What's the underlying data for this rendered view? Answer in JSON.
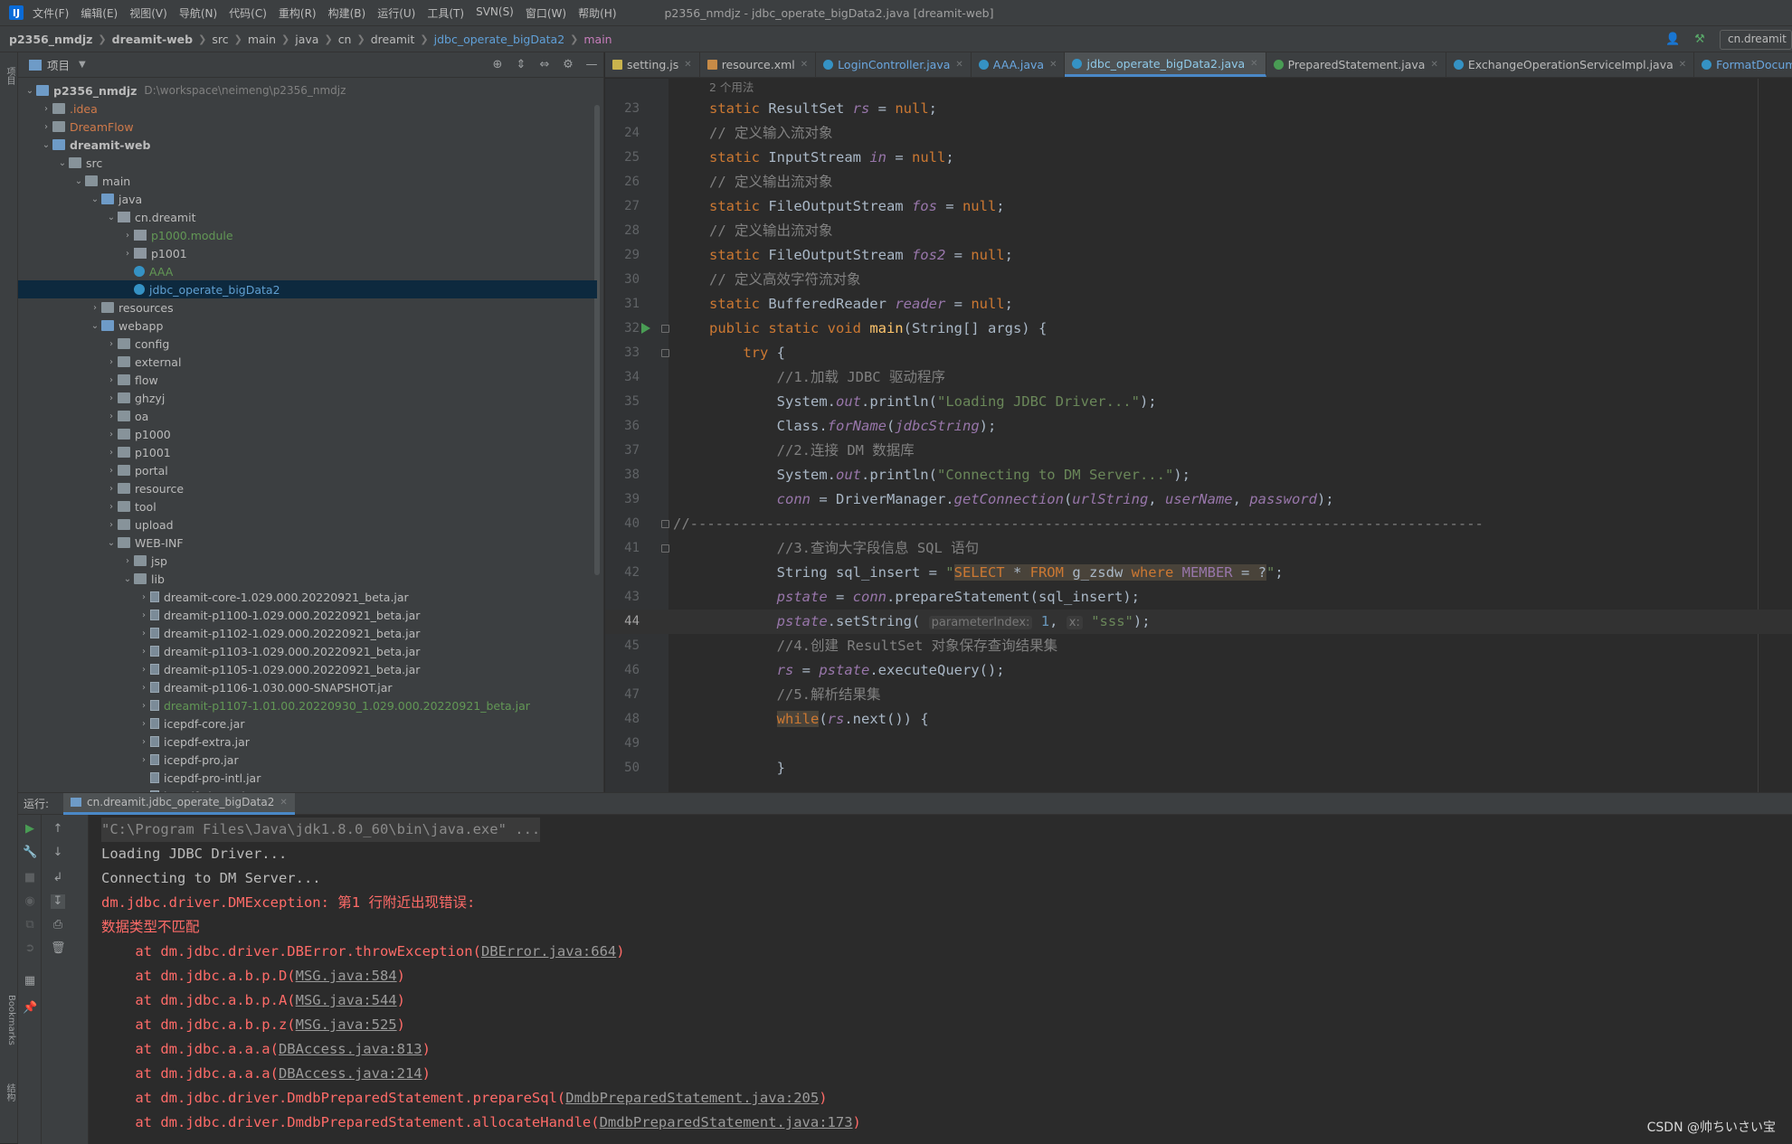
{
  "menubar": {
    "items": [
      "文件(F)",
      "编辑(E)",
      "视图(V)",
      "导航(N)",
      "代码(C)",
      "重构(R)",
      "构建(B)",
      "运行(U)",
      "工具(T)",
      "SVN(S)",
      "窗口(W)",
      "帮助(H)"
    ],
    "window_title": "p2356_nmdjz - jdbc_operate_bigData2.java [dreamit-web]"
  },
  "breadcrumb": [
    "p2356_nmdjz",
    "dreamit-web",
    "src",
    "main",
    "java",
    "cn",
    "dreamit",
    "jdbc_operate_bigData2",
    "main"
  ],
  "run_config": "cn.dreamit",
  "left_strip": {
    "project": "项目",
    "bookmarks": "Bookmarks",
    "structure": "结构"
  },
  "project_panel": {
    "title": "项目",
    "path": "D:\\workspace\\neimeng\\p2356_nmdjz"
  },
  "tree": [
    {
      "label": "p2356_nmdjz",
      "depth": 0,
      "arrow": "open",
      "icon": "folder-blue",
      "style": "bold",
      "path": true
    },
    {
      "label": ".idea",
      "depth": 1,
      "arrow": "closed",
      "icon": "folder",
      "style": "orange"
    },
    {
      "label": "DreamFlow",
      "depth": 1,
      "arrow": "closed",
      "icon": "folder",
      "style": "orange"
    },
    {
      "label": "dreamit-web",
      "depth": 1,
      "arrow": "open",
      "icon": "folder-blue",
      "style": "bold"
    },
    {
      "label": "src",
      "depth": 2,
      "arrow": "open",
      "icon": "folder",
      "style": ""
    },
    {
      "label": "main",
      "depth": 3,
      "arrow": "open",
      "icon": "folder",
      "style": ""
    },
    {
      "label": "java",
      "depth": 4,
      "arrow": "open",
      "icon": "folder-blue",
      "style": ""
    },
    {
      "label": "cn.dreamit",
      "depth": 5,
      "arrow": "open",
      "icon": "pkg",
      "style": ""
    },
    {
      "label": "p1000.module",
      "depth": 6,
      "arrow": "closed",
      "icon": "pkg",
      "style": "green"
    },
    {
      "label": "p1001",
      "depth": 6,
      "arrow": "closed",
      "icon": "pkg",
      "style": ""
    },
    {
      "label": "AAA",
      "depth": 6,
      "arrow": "none",
      "icon": "class",
      "style": "green"
    },
    {
      "label": "jdbc_operate_bigData2",
      "depth": 6,
      "arrow": "none",
      "icon": "class",
      "style": "green",
      "selected": true
    },
    {
      "label": "resources",
      "depth": 4,
      "arrow": "closed",
      "icon": "folder",
      "style": ""
    },
    {
      "label": "webapp",
      "depth": 4,
      "arrow": "open",
      "icon": "folder-blue",
      "style": ""
    },
    {
      "label": "config",
      "depth": 5,
      "arrow": "closed",
      "icon": "folder",
      "style": ""
    },
    {
      "label": "external",
      "depth": 5,
      "arrow": "closed",
      "icon": "folder",
      "style": ""
    },
    {
      "label": "flow",
      "depth": 5,
      "arrow": "closed",
      "icon": "folder",
      "style": ""
    },
    {
      "label": "ghzyj",
      "depth": 5,
      "arrow": "closed",
      "icon": "folder",
      "style": ""
    },
    {
      "label": "oa",
      "depth": 5,
      "arrow": "closed",
      "icon": "folder",
      "style": ""
    },
    {
      "label": "p1000",
      "depth": 5,
      "arrow": "closed",
      "icon": "folder",
      "style": ""
    },
    {
      "label": "p1001",
      "depth": 5,
      "arrow": "closed",
      "icon": "folder",
      "style": ""
    },
    {
      "label": "portal",
      "depth": 5,
      "arrow": "closed",
      "icon": "folder",
      "style": ""
    },
    {
      "label": "resource",
      "depth": 5,
      "arrow": "closed",
      "icon": "folder",
      "style": ""
    },
    {
      "label": "tool",
      "depth": 5,
      "arrow": "closed",
      "icon": "folder",
      "style": ""
    },
    {
      "label": "upload",
      "depth": 5,
      "arrow": "closed",
      "icon": "folder",
      "style": ""
    },
    {
      "label": "WEB-INF",
      "depth": 5,
      "arrow": "open",
      "icon": "folder",
      "style": ""
    },
    {
      "label": "jsp",
      "depth": 6,
      "arrow": "closed",
      "icon": "folder",
      "style": ""
    },
    {
      "label": "lib",
      "depth": 6,
      "arrow": "open",
      "icon": "folder",
      "style": ""
    },
    {
      "label": "dreamit-core-1.029.000.20220921_beta.jar",
      "depth": 7,
      "arrow": "closed",
      "icon": "jar",
      "style": ""
    },
    {
      "label": "dreamit-p1100-1.029.000.20220921_beta.jar",
      "depth": 7,
      "arrow": "closed",
      "icon": "jar",
      "style": ""
    },
    {
      "label": "dreamit-p1102-1.029.000.20220921_beta.jar",
      "depth": 7,
      "arrow": "closed",
      "icon": "jar",
      "style": ""
    },
    {
      "label": "dreamit-p1103-1.029.000.20220921_beta.jar",
      "depth": 7,
      "arrow": "closed",
      "icon": "jar",
      "style": ""
    },
    {
      "label": "dreamit-p1105-1.029.000.20220921_beta.jar",
      "depth": 7,
      "arrow": "closed",
      "icon": "jar",
      "style": ""
    },
    {
      "label": "dreamit-p1106-1.030.000-SNAPSHOT.jar",
      "depth": 7,
      "arrow": "closed",
      "icon": "jar",
      "style": ""
    },
    {
      "label": "dreamit-p1107-1.01.00.20220930_1.029.000.20220921_beta.jar",
      "depth": 7,
      "arrow": "closed",
      "icon": "jar",
      "style": "green"
    },
    {
      "label": "icepdf-core.jar",
      "depth": 7,
      "arrow": "closed",
      "icon": "jar",
      "style": ""
    },
    {
      "label": "icepdf-extra.jar",
      "depth": 7,
      "arrow": "closed",
      "icon": "jar",
      "style": ""
    },
    {
      "label": "icepdf-pro.jar",
      "depth": 7,
      "arrow": "closed",
      "icon": "jar",
      "style": ""
    },
    {
      "label": "icepdf-pro-intl.jar",
      "depth": 7,
      "arrow": "none",
      "icon": "jar",
      "style": ""
    },
    {
      "label": "icepdf-viewer.jar",
      "depth": 7,
      "arrow": "closed",
      "icon": "jar",
      "style": ""
    }
  ],
  "tabs": [
    {
      "label": "setting.js",
      "icon": "js"
    },
    {
      "label": "resource.xml",
      "icon": "xml"
    },
    {
      "label": "LoginController.java",
      "icon": "class",
      "blue": true
    },
    {
      "label": "AAA.java",
      "icon": "class",
      "blue": true
    },
    {
      "label": "jdbc_operate_bigData2.java",
      "icon": "class",
      "active": true
    },
    {
      "label": "PreparedStatement.java",
      "icon": "green"
    },
    {
      "label": "ExchangeOperationServiceImpl.java",
      "icon": "class"
    },
    {
      "label": "FormatDocumentControl",
      "icon": "class",
      "blue": true
    }
  ],
  "usages_hint": "2 个用法",
  "code": [
    {
      "n": "23",
      "t": [
        [
          "kw",
          "static "
        ],
        [
          "",
          "ResultSet "
        ],
        [
          "fld",
          "rs"
        ],
        [
          "",
          " = "
        ],
        [
          "kw",
          "null"
        ],
        [
          "",
          ";"
        ]
      ]
    },
    {
      "n": "24",
      "t": [
        [
          "cm",
          "// 定义输入流对象"
        ]
      ]
    },
    {
      "n": "25",
      "t": [
        [
          "kw",
          "static "
        ],
        [
          "",
          "InputStream "
        ],
        [
          "fld",
          "in"
        ],
        [
          "",
          " = "
        ],
        [
          "kw",
          "null"
        ],
        [
          "",
          ";"
        ]
      ]
    },
    {
      "n": "26",
      "t": [
        [
          "cm",
          "// 定义输出流对象"
        ]
      ]
    },
    {
      "n": "27",
      "t": [
        [
          "kw",
          "static "
        ],
        [
          "",
          "FileOutputStream "
        ],
        [
          "fld",
          "fos"
        ],
        [
          "",
          " = "
        ],
        [
          "kw",
          "null"
        ],
        [
          "",
          ";"
        ]
      ]
    },
    {
      "n": "28",
      "t": [
        [
          "cm",
          "// 定义输出流对象"
        ]
      ]
    },
    {
      "n": "29",
      "t": [
        [
          "kw",
          "static "
        ],
        [
          "",
          "FileOutputStream "
        ],
        [
          "fld",
          "fos2"
        ],
        [
          "",
          " = "
        ],
        [
          "kw",
          "null"
        ],
        [
          "",
          ";"
        ]
      ]
    },
    {
      "n": "30",
      "t": [
        [
          "cm",
          "// 定义高效字符流对象"
        ]
      ]
    },
    {
      "n": "31",
      "t": [
        [
          "kw",
          "static "
        ],
        [
          "",
          "BufferedReader "
        ],
        [
          "fld",
          "reader"
        ],
        [
          "",
          " = "
        ],
        [
          "kw",
          "null"
        ],
        [
          "",
          ";"
        ]
      ]
    },
    {
      "n": "32",
      "t": [
        [
          "kw",
          "public static void "
        ],
        [
          "mth",
          "main"
        ],
        [
          "",
          "(String[] args) {"
        ]
      ]
    },
    {
      "n": "33",
      "t": [
        [
          "",
          "    "
        ],
        [
          "kw",
          "try "
        ],
        [
          "",
          "{"
        ]
      ]
    },
    {
      "n": "34",
      "t": [
        [
          "",
          "        "
        ],
        [
          "cm",
          "//1.加载 JDBC 驱动程序"
        ]
      ]
    },
    {
      "n": "35",
      "t": [
        [
          "",
          "        System."
        ],
        [
          "fld",
          "out"
        ],
        [
          "",
          ".println("
        ],
        [
          "st",
          "\"Loading JDBC Driver...\""
        ],
        [
          "",
          ");"
        ]
      ]
    },
    {
      "n": "36",
      "t": [
        [
          "",
          "        Class."
        ],
        [
          "fld",
          "forName"
        ],
        [
          "",
          "("
        ],
        [
          "fld",
          "jdbcString"
        ],
        [
          "",
          ");"
        ]
      ]
    },
    {
      "n": "37",
      "t": [
        [
          "",
          "        "
        ],
        [
          "cm",
          "//2.连接 DM 数据库"
        ]
      ]
    },
    {
      "n": "38",
      "t": [
        [
          "",
          "        System."
        ],
        [
          "fld",
          "out"
        ],
        [
          "",
          ".println("
        ],
        [
          "st",
          "\"Connecting to DM Server...\""
        ],
        [
          "",
          ");"
        ]
      ]
    },
    {
      "n": "39",
      "t": [
        [
          "",
          "        "
        ],
        [
          "fld",
          "conn"
        ],
        [
          "",
          " = DriverManager."
        ],
        [
          "fld",
          "getConnection"
        ],
        [
          "",
          "("
        ],
        [
          "fld",
          "urlString"
        ],
        [
          "",
          ", "
        ],
        [
          "fld",
          "userName"
        ],
        [
          "",
          ", "
        ],
        [
          "fld",
          "password"
        ],
        [
          "",
          ");"
        ]
      ]
    },
    {
      "n": "40",
      "t": [
        [
          "cm",
          "//----------------------------------------------------------------------------------------------"
        ]
      ],
      "outdent": true
    },
    {
      "n": "41",
      "t": [
        [
          "",
          "        "
        ],
        [
          "cm",
          "//3.查询大字段信息 SQL 语句"
        ]
      ]
    },
    {
      "n": "42",
      "t": [
        [
          "",
          "        String sql_insert = "
        ],
        [
          "st",
          "\""
        ],
        [
          "sqlkw hl",
          "SELECT "
        ],
        [
          "sqlid hl",
          "* "
        ],
        [
          "sqlkw hl",
          "FROM "
        ],
        [
          "sqlid hl",
          "g_zsdw "
        ],
        [
          "sqlkw hl",
          "where "
        ],
        [
          "sqlcol hl",
          "MEMBER "
        ],
        [
          "sqlid hl",
          "= ?"
        ],
        [
          "st",
          "\""
        ],
        [
          "",
          ";"
        ]
      ]
    },
    {
      "n": "43",
      "t": [
        [
          "",
          "        "
        ],
        [
          "fld",
          "pstate"
        ],
        [
          "",
          " = "
        ],
        [
          "fld",
          "conn"
        ],
        [
          "",
          ".prepareStatement(sql_insert);"
        ]
      ]
    },
    {
      "n": "44",
      "cur": true,
      "t": [
        [
          "",
          "        "
        ],
        [
          "fld",
          "pstate"
        ],
        [
          "",
          ".setString( "
        ],
        [
          "hint",
          "parameterIndex:"
        ],
        [
          "num",
          " 1"
        ],
        [
          "",
          ", "
        ],
        [
          "hint",
          "x:"
        ],
        [
          "st",
          " \"sss\""
        ],
        [
          "",
          ");"
        ]
      ]
    },
    {
      "n": "45",
      "t": [
        [
          "",
          "        "
        ],
        [
          "cm",
          "//4.创建 ResultSet 对象保存查询结果集"
        ]
      ]
    },
    {
      "n": "46",
      "t": [
        [
          "",
          "        "
        ],
        [
          "fld",
          "rs"
        ],
        [
          "",
          " = "
        ],
        [
          "fld",
          "pstate"
        ],
        [
          "",
          ".executeQuery();"
        ]
      ]
    },
    {
      "n": "47",
      "t": [
        [
          "",
          "        "
        ],
        [
          "cm",
          "//5.解析结果集"
        ]
      ]
    },
    {
      "n": "48",
      "t": [
        [
          "",
          "        "
        ],
        [
          "kw hl",
          "while"
        ],
        [
          "",
          "("
        ],
        [
          "fld",
          "rs"
        ],
        [
          "",
          ".next()) {"
        ]
      ]
    },
    {
      "n": "49",
      "t": []
    },
    {
      "n": "50",
      "t": [
        [
          "",
          "        }"
        ]
      ]
    }
  ],
  "run_panel": {
    "label": "运行:",
    "tab": "cn.dreamit.jdbc_operate_bigData2"
  },
  "console": [
    {
      "kind": "cmd",
      "text": "\"C:\\Program Files\\Java\\jdk1.8.0_60\\bin\\java.exe\" ..."
    },
    {
      "kind": "out",
      "text": "Loading JDBC Driver..."
    },
    {
      "kind": "out",
      "text": "Connecting to DM Server..."
    },
    {
      "kind": "err",
      "text": "dm.jdbc.driver.DMException: 第1 行附近出现错误:"
    },
    {
      "kind": "err",
      "text": "数据类型不匹配"
    },
    {
      "kind": "err",
      "pre": "    at dm.jdbc.driver.DBError.throwException(",
      "link": "DBError.java:664",
      "post": ")"
    },
    {
      "kind": "err",
      "pre": "    at dm.jdbc.a.b.p.D(",
      "link": "MSG.java:584",
      "post": ")"
    },
    {
      "kind": "err",
      "pre": "    at dm.jdbc.a.b.p.A(",
      "link": "MSG.java:544",
      "post": ")"
    },
    {
      "kind": "err",
      "pre": "    at dm.jdbc.a.b.p.z(",
      "link": "MSG.java:525",
      "post": ")"
    },
    {
      "kind": "err",
      "pre": "    at dm.jdbc.a.a.a(",
      "link": "DBAccess.java:813",
      "post": ")"
    },
    {
      "kind": "err",
      "pre": "    at dm.jdbc.a.a.a(",
      "link": "DBAccess.java:214",
      "post": ")"
    },
    {
      "kind": "err",
      "pre": "    at dm.jdbc.driver.DmdbPreparedStatement.prepareSql(",
      "link": "DmdbPreparedStatement.java:205",
      "post": ")"
    },
    {
      "kind": "err",
      "pre": "    at dm.jdbc.driver.DmdbPreparedStatement.allocateHandle(",
      "link": "DmdbPreparedStatement.java:173",
      "post": ")"
    }
  ],
  "watermark": "CSDN @帅ちいさい宝"
}
